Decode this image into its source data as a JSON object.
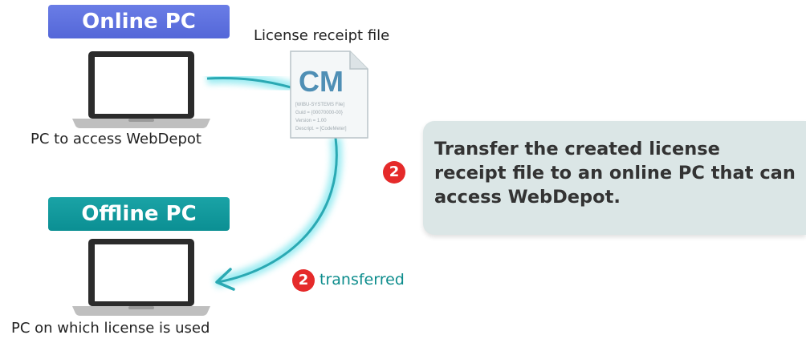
{
  "online_pc": {
    "badge": "Online PC",
    "caption": "PC to access WebDepot"
  },
  "offline_pc": {
    "badge": "Offline PC",
    "caption": "PC on which license is used"
  },
  "file": {
    "label": "License receipt file",
    "icon_text": "CM",
    "icon_lines": [
      "[WIBU-SYSTEMS File]",
      "Guid = {00070000-00}",
      "Version = 1.00",
      "Descript. = [CodeMeter]"
    ]
  },
  "callout": {
    "step": "2",
    "text": "Transfer the created license receipt file to an online PC that can access WebDepot."
  },
  "transfer": {
    "step": "2",
    "label": "transferred"
  },
  "colors": {
    "online_badge": "#5467d8",
    "offline_badge": "#0b8f93",
    "step_badge": "#e52a2a",
    "callout_bg": "#dbe6e6",
    "glow": "#67e0e8"
  }
}
